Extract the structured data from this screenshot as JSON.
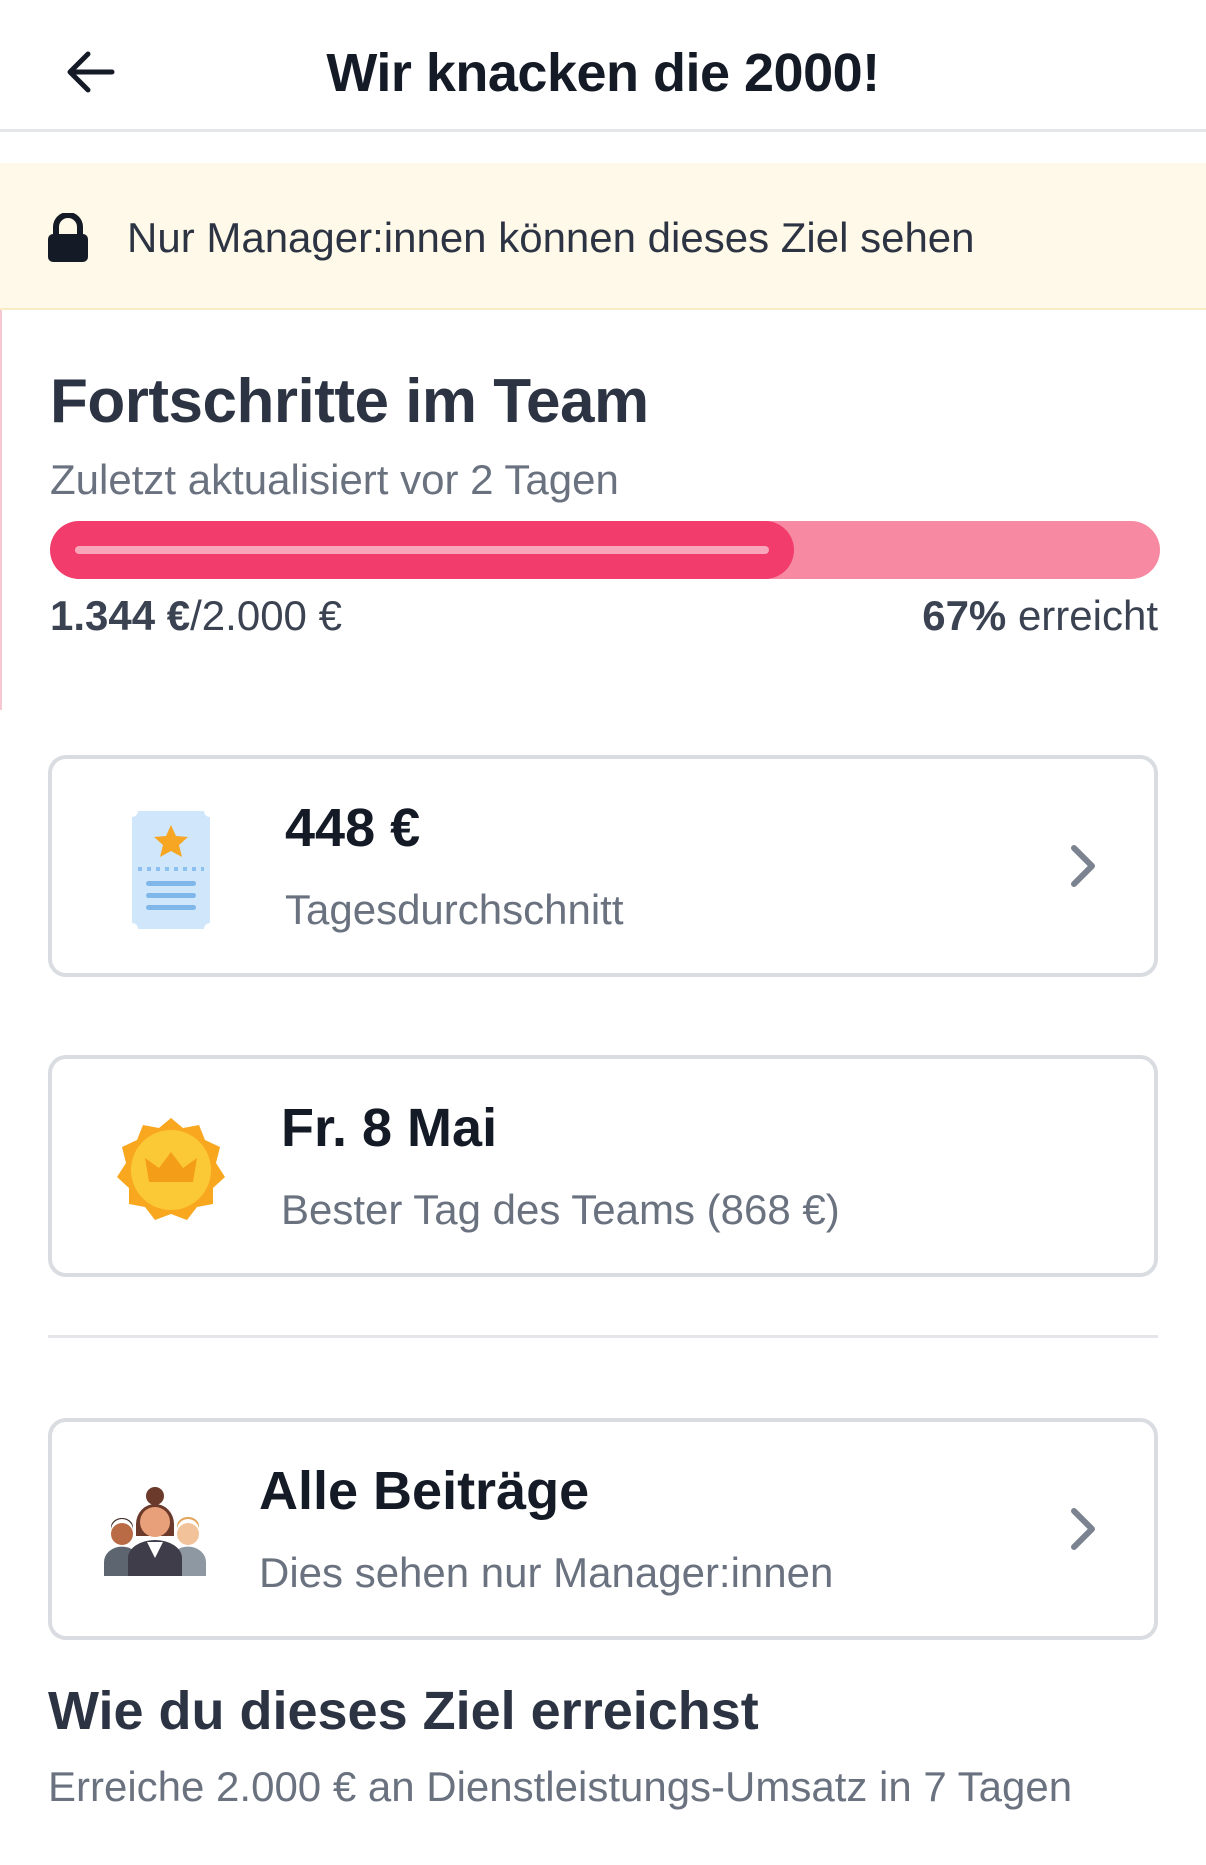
{
  "header": {
    "title": "Wir knacken die 2000!",
    "back_icon": "arrow-left-icon"
  },
  "notice": {
    "icon": "lock-icon",
    "text": "Nur Manager:innen können dieses Ziel sehen"
  },
  "progress": {
    "title": "Fortschritte im Team",
    "updated": "Zuletzt aktualisiert vor 2 Tagen",
    "fraction": 0.67,
    "current": "1.344 €",
    "target": "/2.000 €",
    "percent": "67%",
    "percent_suffix": " erreicht",
    "colors": {
      "fill": "#f13c6c",
      "track": "#f78aa2"
    }
  },
  "cards": {
    "average": {
      "icon": "ticket-star-icon",
      "value": "448 €",
      "label": "Tagesdurchschnitt",
      "chevron": "chevron-right-icon"
    },
    "best_day": {
      "icon": "crown-badge-icon",
      "value": "Fr. 8 Mai",
      "label": "Bester Tag des Teams (868 €)"
    },
    "contributions": {
      "icon": "team-people-icon",
      "value": "Alle Beiträge",
      "label": "Dies sehen nur Manager:innen",
      "chevron": "chevron-right-icon"
    }
  },
  "how": {
    "title": "Wie du dieses Ziel erreichst",
    "text": "Erreiche 2.000 € an Dienstleistungs-Umsatz in 7 Tagen"
  }
}
